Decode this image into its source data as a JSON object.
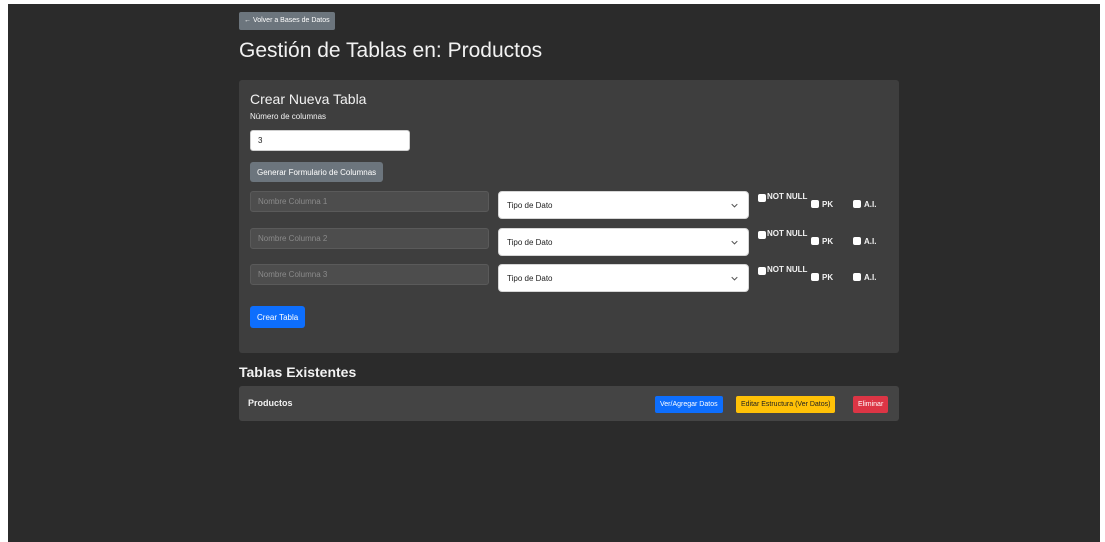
{
  "nav": {
    "back_label": "← Volver a Bases de Datos"
  },
  "page": {
    "title": "Gestión de Tablas en: Productos"
  },
  "create_panel": {
    "title": "Crear Nueva Tabla",
    "columns_label": "Número de columnas",
    "columns_value": "3",
    "generate_label": "Generar Formulario de Columnas",
    "name_placeholders": [
      "Nombre Columna 1",
      "Nombre Columna 2",
      "Nombre Columna 3"
    ],
    "type_selected": "Tipo de Dato",
    "not_null_label": "NOT NULL",
    "pk_label": "PK",
    "ai_label": "A.I.",
    "create_label": "Crear Tabla"
  },
  "existing": {
    "title": "Tablas Existentes",
    "tables": [
      {
        "name": "Productos",
        "view_label": "Ver/Agregar Datos",
        "edit_label": "Editar Estructura (Ver Datos)",
        "delete_label": "Eliminar"
      }
    ]
  },
  "colors": {
    "background": "#2b2b2b",
    "panel": "#3e3e3e",
    "primary": "#0d6efd",
    "secondary": "#6c757d",
    "warning": "#ffc107",
    "danger": "#dc3545"
  }
}
